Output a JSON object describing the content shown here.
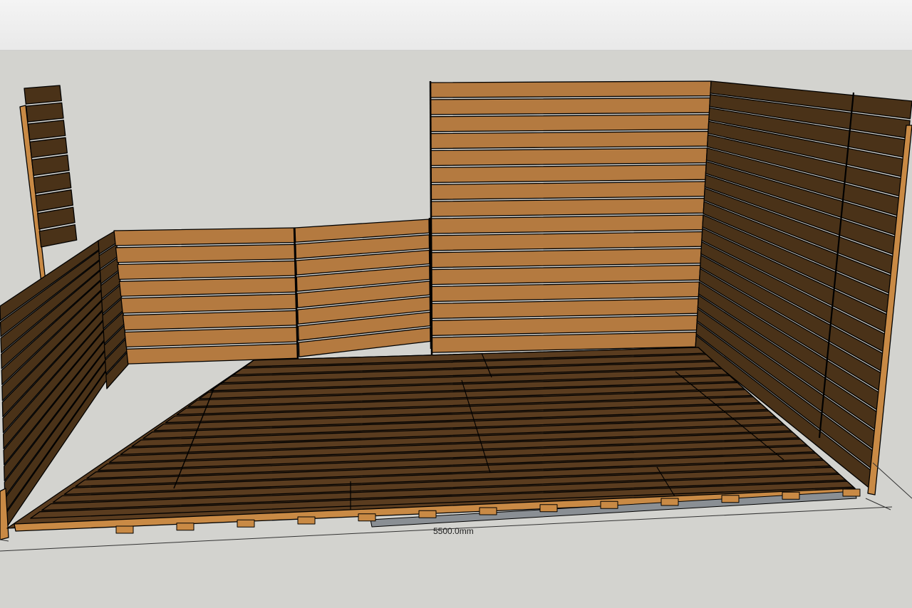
{
  "model": {
    "dimension_label": "5500.0mm"
  },
  "colors": {
    "background": "#d3d3cf",
    "toolbar": "#eeeeee",
    "light_wood": "#b47a40",
    "dark_wood": "#4a3218",
    "floor_wood": "#5a3c1f",
    "joist": "#c98a45",
    "concrete": "#8a8f94",
    "edge": "#000000"
  }
}
